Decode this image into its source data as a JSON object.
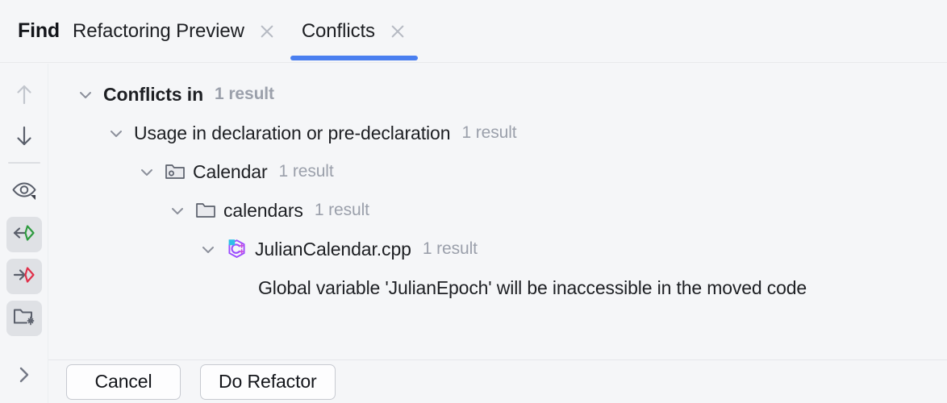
{
  "window": {
    "tool_title": "Find"
  },
  "tabs": [
    {
      "label": "Refactoring Preview",
      "active": false,
      "close_icon": "close-icon"
    },
    {
      "label": "Conflicts",
      "active": true,
      "close_icon": "close-icon"
    }
  ],
  "toolbar": {
    "items": [
      {
        "name": "previous-occurrence-button",
        "icon": "arrow-up-icon",
        "label": "Previous Occurrence",
        "selected": false,
        "disabled": true
      },
      {
        "name": "next-occurrence-button",
        "icon": "arrow-down-icon",
        "label": "Next Occurrence",
        "selected": false,
        "disabled": false
      },
      {
        "name": "preview-usages-button",
        "icon": "eye-icon",
        "label": "Preview Usages",
        "selected": false,
        "disabled": false
      },
      {
        "name": "show-read-access-button",
        "icon": "read-access-icon",
        "label": "Show Read Access",
        "selected": true,
        "disabled": false
      },
      {
        "name": "show-write-access-button",
        "icon": "write-access-icon",
        "label": "Show Write Access",
        "selected": true,
        "disabled": false
      },
      {
        "name": "group-by-directory-button",
        "icon": "folder-sparkle-icon",
        "label": "Group by Directory",
        "selected": true,
        "disabled": false
      }
    ],
    "expand_toolbar": {
      "name": "expand-toolbar-button",
      "icon": "chevron-right-icon",
      "label": "Expand Toolbar"
    }
  },
  "tree": {
    "nodes": [
      {
        "id": "root",
        "label": "Conflicts in",
        "count": "1 result",
        "bold": true,
        "expanded": true,
        "icon": null,
        "indent": 0
      },
      {
        "id": "usage-group",
        "label": "Usage in declaration or pre-declaration",
        "count": "1 result",
        "bold": false,
        "expanded": true,
        "icon": null,
        "indent": 1
      },
      {
        "id": "module-calendar",
        "label": "Calendar",
        "count": "1 result",
        "bold": false,
        "expanded": true,
        "icon": "module-folder-icon",
        "indent": 2
      },
      {
        "id": "dir-calendars",
        "label": "calendars",
        "count": "1 result",
        "bold": false,
        "expanded": true,
        "icon": "folder-icon",
        "indent": 3
      },
      {
        "id": "file-juliancalendar",
        "label": "JulianCalendar.cpp",
        "count": "1 result",
        "bold": false,
        "expanded": true,
        "icon": "cpp-file-icon",
        "indent": 4
      }
    ],
    "conflict_message": "Global variable 'JulianEpoch' will be inaccessible in the moved code"
  },
  "buttons": {
    "cancel": "Cancel",
    "do_refactor": "Do Refactor"
  },
  "colors": {
    "accent": "#4a7ff0",
    "background": "#f5f6f8",
    "text": "#1d1f23",
    "muted_text": "#9ba0ab",
    "icon_stroke": "#5a5f6b",
    "read_access_green": "#2e9b3f",
    "write_access_red": "#e0304a",
    "cpp_purple": "#9b4dff",
    "cpp_badge_cyan": "#2fc0e8"
  }
}
